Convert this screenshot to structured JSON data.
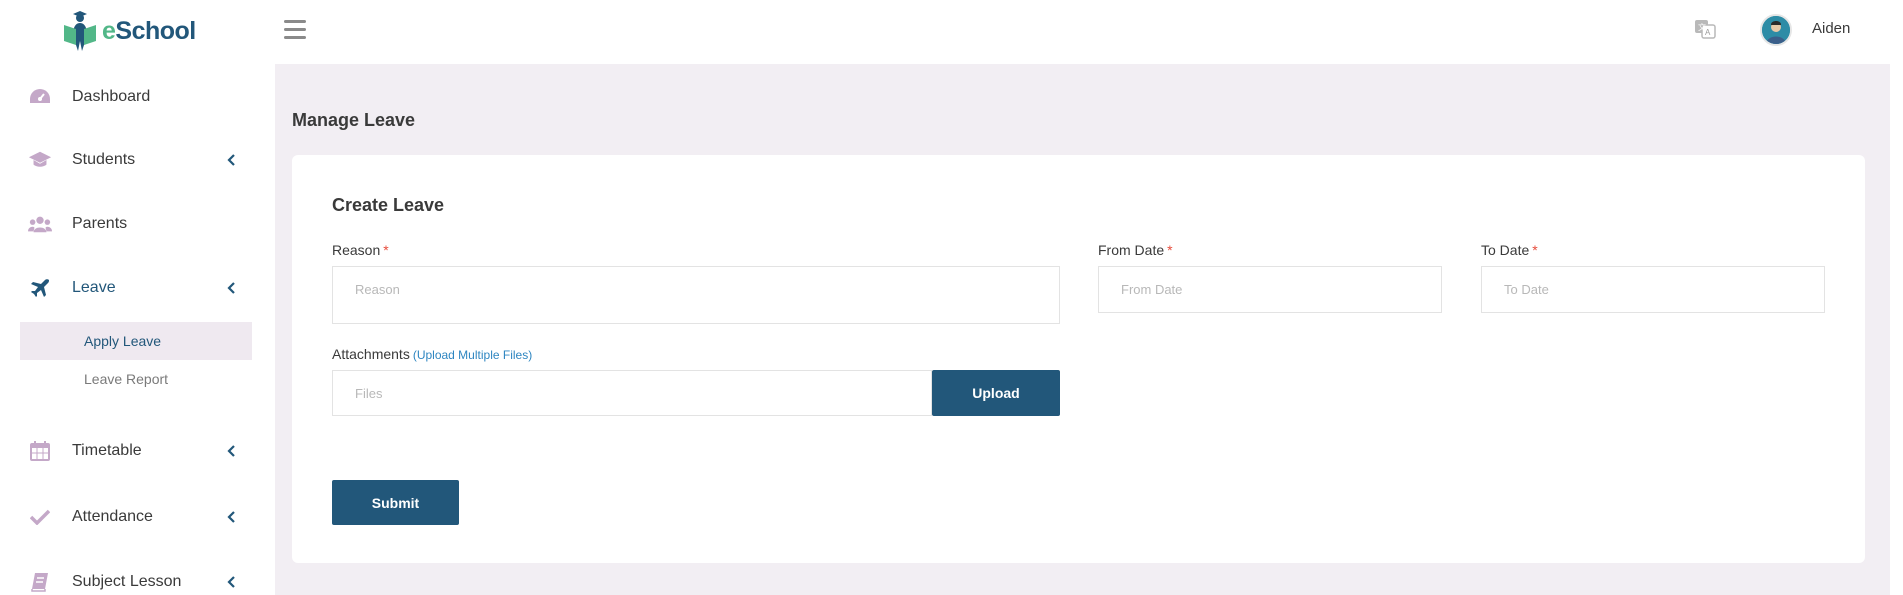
{
  "brand": {
    "name_e": "e",
    "name_rest": "School"
  },
  "sidebar": {
    "items": [
      {
        "label": "Dashboard",
        "icon": "dashboard-icon"
      },
      {
        "label": "Students",
        "icon": "graduation-cap-icon"
      },
      {
        "label": "Parents",
        "icon": "users-icon"
      },
      {
        "label": "Leave",
        "icon": "plane-icon",
        "active": true
      },
      {
        "label": "Timetable",
        "icon": "calendar-icon"
      },
      {
        "label": "Attendance",
        "icon": "check-icon"
      },
      {
        "label": "Subject Lesson",
        "icon": "book-icon"
      }
    ],
    "leave_sub": [
      {
        "label": "Apply Leave",
        "active": true
      },
      {
        "label": "Leave Report"
      }
    ]
  },
  "header": {
    "user_name": "Aiden",
    "language_icon": "language-icon",
    "menu_icon": "hamburger-icon"
  },
  "page": {
    "title": "Manage Leave",
    "card_title": "Create Leave",
    "form": {
      "reason_label": "Reason",
      "reason_placeholder": "Reason",
      "from_label": "From Date",
      "from_placeholder": "From Date",
      "to_label": "To Date",
      "to_placeholder": "To Date",
      "required_mark": "*",
      "attachments_label": "Attachments",
      "attachments_hint": "(Upload Multiple Files)",
      "files_placeholder": "Files",
      "upload_label": "Upload",
      "submit_label": "Submit"
    }
  },
  "colors": {
    "primary": "#22577a",
    "accent_green": "#52b788",
    "sidebar_icon": "#c4a8c8",
    "background": "#f2eef3",
    "required": "#e74c3c",
    "hint": "#2e86c1"
  }
}
